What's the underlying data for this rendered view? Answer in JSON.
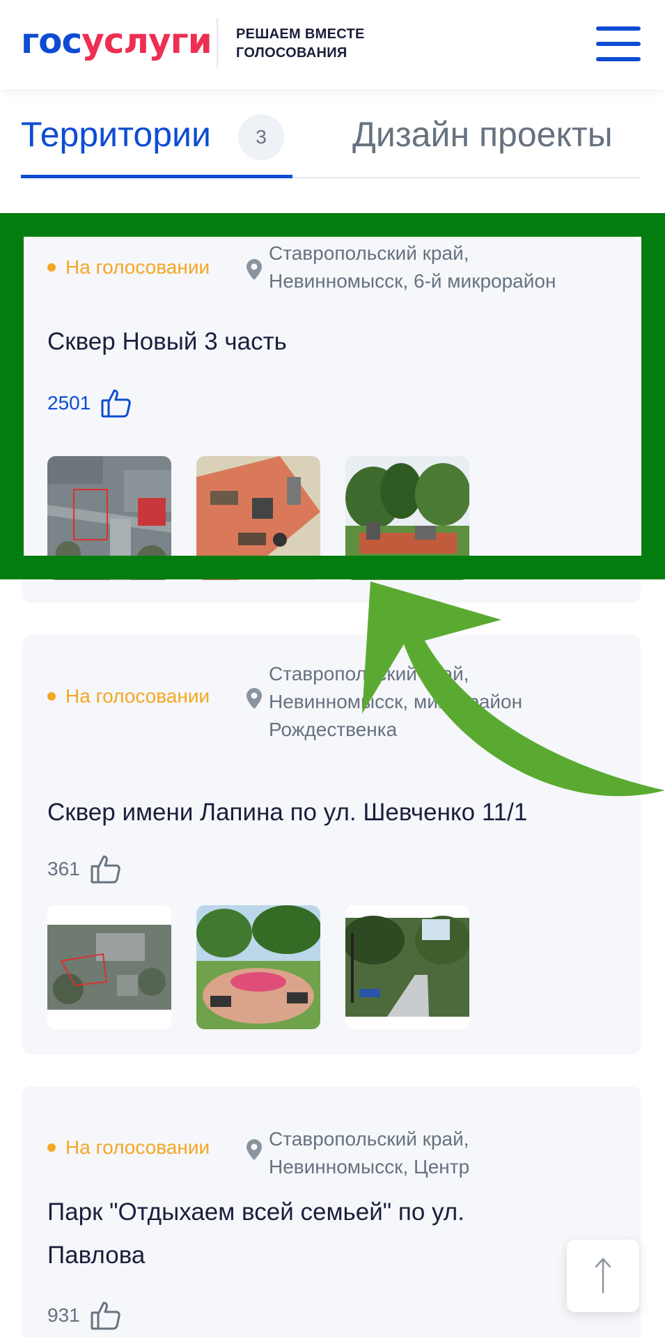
{
  "header": {
    "logo_part1": "гос",
    "logo_part2": "услуги",
    "tagline_line1": "РЕШАЕМ ВМЕСТЕ",
    "tagline_line2": "ГОЛОСОВАНИЯ",
    "menu_icon": "hamburger-menu-icon"
  },
  "tabs": [
    {
      "label": "Территории",
      "count": "3",
      "active": true
    },
    {
      "label": "Дизайн проекты",
      "active": false
    }
  ],
  "cards": [
    {
      "status": "На голосовании",
      "location_lines": [
        "Ставропольский край,",
        "Невинномысск, 6-й микрорайон"
      ],
      "title": "Сквер Новый 3 часть",
      "likes": "2501"
    },
    {
      "status": "На голосовании",
      "location_lines": [
        "Ставропольский край,",
        "Невинномысск, микрорайон",
        "Рождественка"
      ],
      "title": "Сквер имени Лапина по ул. Шевченко 11/1",
      "likes": "361"
    },
    {
      "status": "На голосовании",
      "location_lines": [
        "Ставропольский край,",
        "Невинномысск, Центр"
      ],
      "title_lines": [
        "Парк \"Отдыхаем всей семьей\" по ул.",
        "Павлова"
      ],
      "likes": "931"
    }
  ],
  "colors": {
    "brand_blue": "#0d4cd3",
    "brand_red": "#ee2f53",
    "status_orange": "#f5a623",
    "highlight_green": "#047d10",
    "arrow_green": "#5aaa32"
  }
}
